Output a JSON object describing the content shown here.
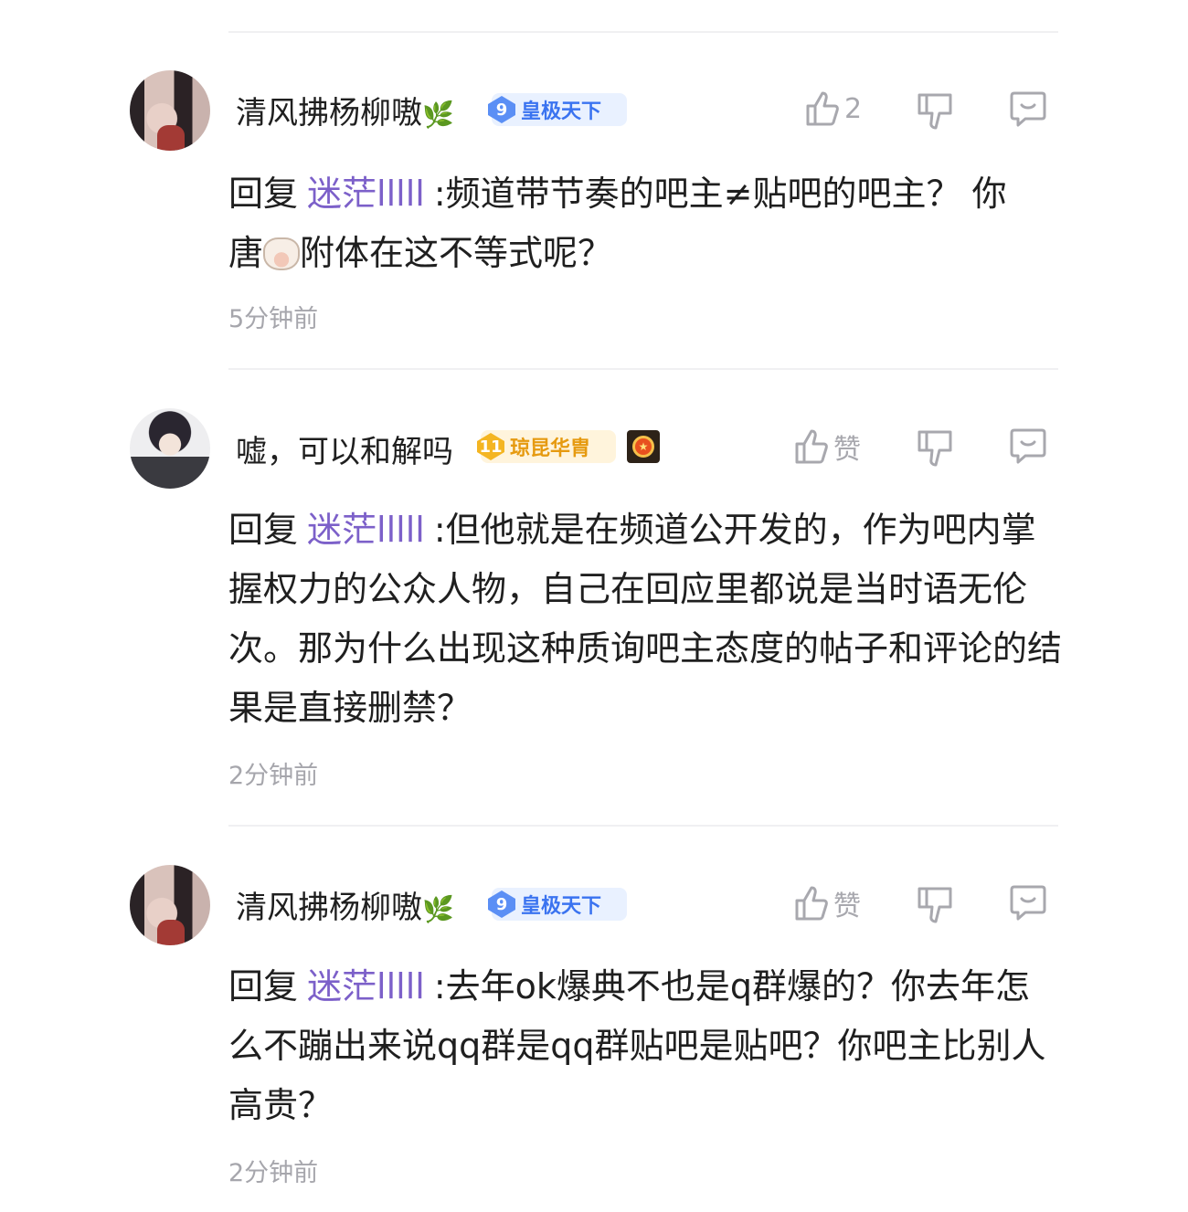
{
  "comments": [
    {
      "username": "清风拂杨柳嗷",
      "badge_level": "9",
      "badge_title": "皇极天下",
      "like_label": "2",
      "reply_prefix": "回复",
      "mention": "迷茫lllll",
      "text_line1": ":频道带节奏的吧主≠贴吧的吧主？ 你",
      "text_line2a": "唐",
      "text_line2b": "附体在这不等式呢？",
      "time": "5分钟前"
    },
    {
      "username": "嘘，可以和解吗",
      "badge_level": "11",
      "badge_title": "琼昆华胄",
      "like_label": "赞",
      "reply_prefix": "回复",
      "mention": "迷茫lllll",
      "text": ":但他就是在频道公开发的，作为吧内掌握权力的公众人物，自己在回应里都说是当时语无伦次。那为什么出现这种质询吧主态度的帖子和评论的结果是直接删禁？",
      "time": "2分钟前"
    },
    {
      "username": "清风拂杨柳嗷",
      "badge_level": "9",
      "badge_title": "皇极天下",
      "like_label": "赞",
      "reply_prefix": "回复",
      "mention": "迷茫lllll",
      "text": ":去年ok爆典不也是q群爆的？你去年怎么不蹦出来说qq群是qq群贴吧是贴吧？你吧主比别人高贵？",
      "time": "2分钟前"
    }
  ],
  "icons": {
    "like": "thumbs-up-icon",
    "dislike": "thumbs-down-icon",
    "reply": "comment-bubble-icon",
    "leaf": "leaf-icon",
    "medal": "medal-icon",
    "cow": "cow-emoji"
  },
  "colors": {
    "mention": "#7c60c9",
    "muted": "#a6a6ac",
    "badge_blue": "#3a73f0",
    "badge_gold": "#e69a10"
  }
}
